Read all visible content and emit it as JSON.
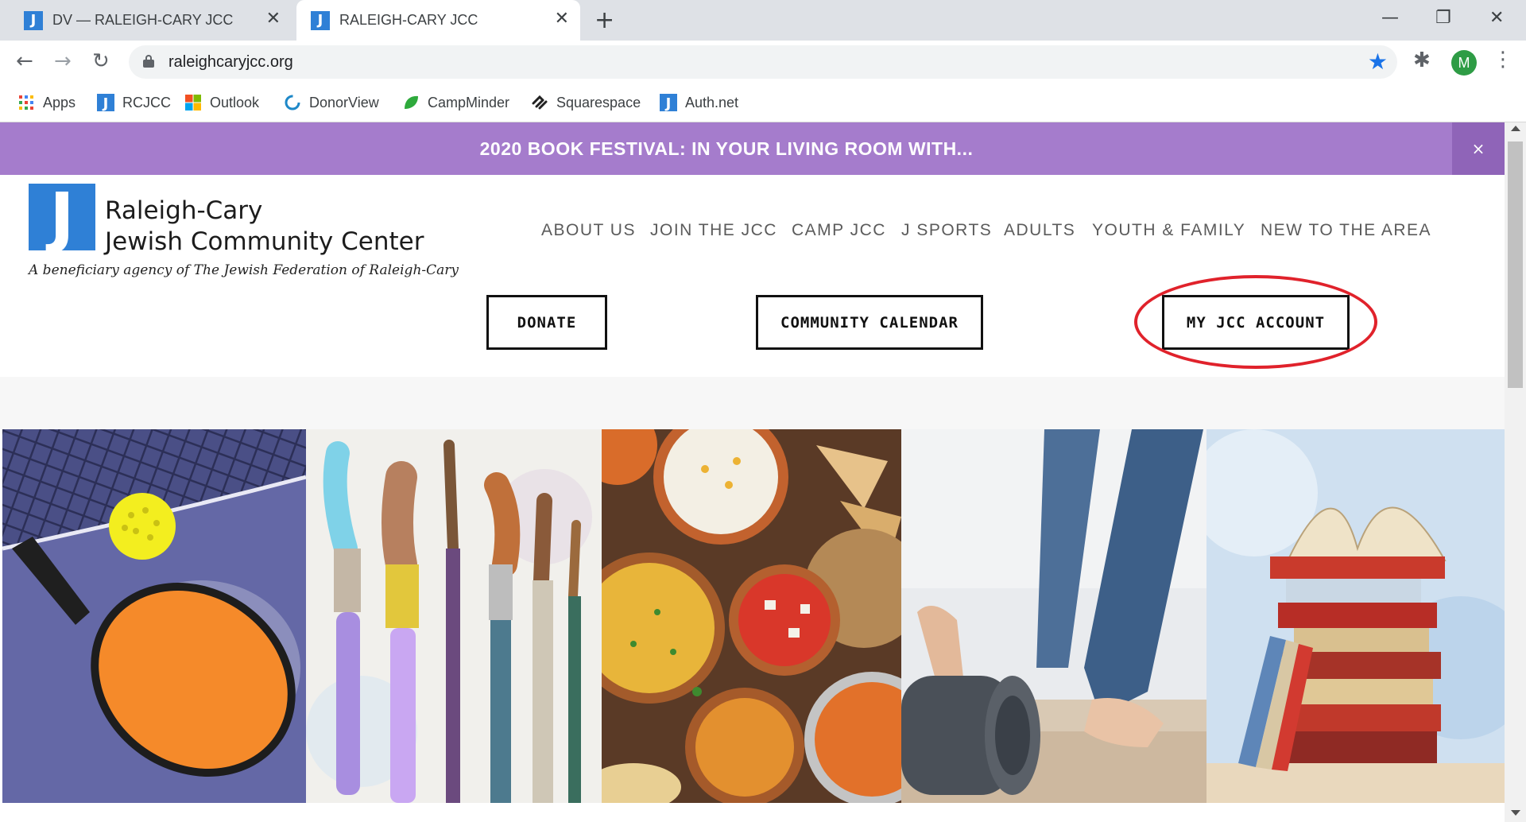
{
  "browser": {
    "tabs": [
      {
        "favicon": "J",
        "title": "DV — RALEIGH-CARY JCC",
        "active": false
      },
      {
        "favicon": "J",
        "title": "RALEIGH-CARY JCC",
        "active": true
      }
    ],
    "url": "raleighcaryjcc.org",
    "profile_initial": "M",
    "bookmarks": [
      {
        "label": "Apps",
        "icon": "apps-grid-icon"
      },
      {
        "label": "RCJCC",
        "icon": "jcc-icon"
      },
      {
        "label": "Outlook",
        "icon": "windows-logo-icon"
      },
      {
        "label": "DonorView",
        "icon": "donorview-icon"
      },
      {
        "label": "CampMinder",
        "icon": "campminder-leaf-icon"
      },
      {
        "label": "Squarespace",
        "icon": "squarespace-icon"
      },
      {
        "label": "Auth.net",
        "icon": "jcc-icon"
      }
    ]
  },
  "site": {
    "banner": {
      "text": "2020 BOOK FESTIVAL: IN YOUR LIVING ROOM WITH...",
      "close": "×",
      "color": "#a57ccc"
    },
    "logo": {
      "mark": "J",
      "line1": "Raleigh-Cary",
      "line2": "Jewish Community Center",
      "tagline": "A beneficiary agency of The Jewish Federation of Raleigh-Cary",
      "brand_color": "#2f80d6"
    },
    "nav": [
      "ABOUT US",
      "JOIN THE JCC",
      "CAMP JCC",
      "J SPORTS",
      "ADULTS",
      "YOUTH & FAMILY",
      "NEW TO THE AREA"
    ],
    "buttons": {
      "donate": "DONATE",
      "calendar": "COMMUNITY CALENDAR",
      "account": "MY JCC ACCOUNT"
    },
    "highlight_color": "#e0222b",
    "gallery": [
      {
        "subject": "pickleball paddle and ball"
      },
      {
        "subject": "paint brushes"
      },
      {
        "subject": "food dishes"
      },
      {
        "subject": "yoga mat"
      },
      {
        "subject": "stack of books"
      }
    ]
  }
}
